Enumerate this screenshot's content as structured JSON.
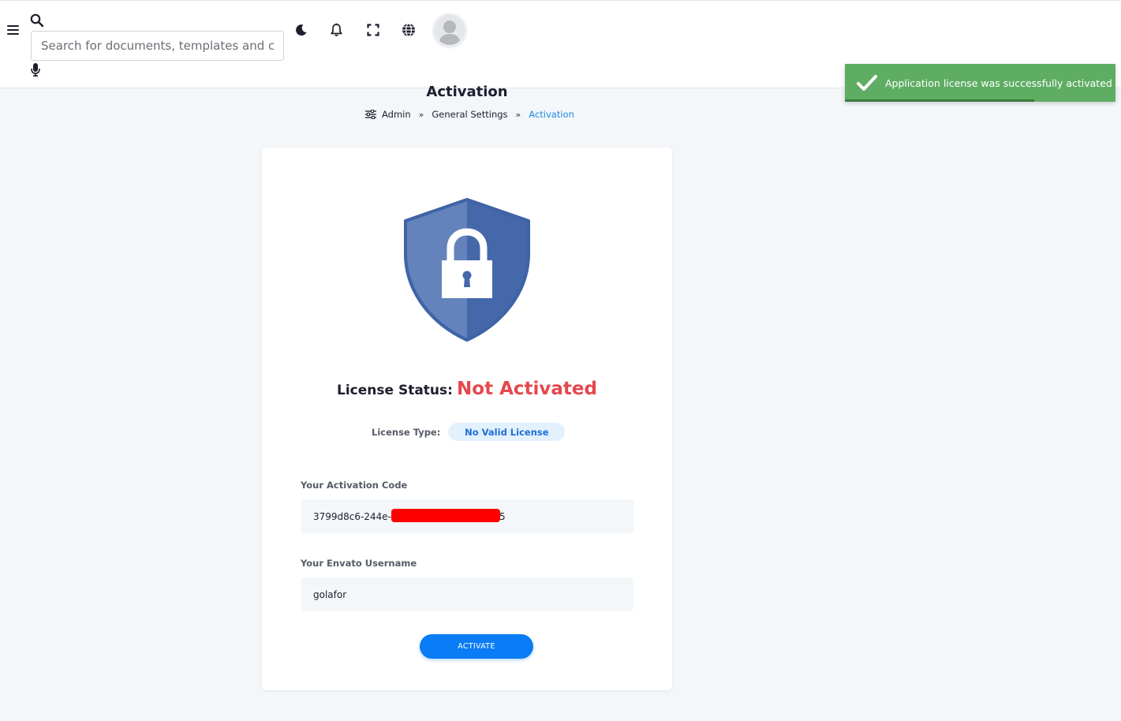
{
  "header": {
    "search_placeholder": "Search for documents, templates and chatbots..."
  },
  "toast": {
    "message": "Application license was successfully activated",
    "progress_percent": 70
  },
  "page": {
    "title": "Activation",
    "breadcrumb": [
      "Admin",
      "General Settings",
      "Activation"
    ],
    "breadcrumb_separator": "»"
  },
  "card": {
    "status_label": "License Status:",
    "status_value": "Not Activated",
    "type_label": "License Type:",
    "type_value": "No Valid License",
    "activation_code_label": "Your Activation Code",
    "activation_code_value": "3799d8c6-244e-                              e025",
    "username_label": "Your Envato Username",
    "username_value": "golafor",
    "activate_label": "ACTIVATE"
  },
  "colors": {
    "accent": "#0a7cf5",
    "status_error": "#e5484d",
    "toast_bg": "#5fad63",
    "shield": "#4a6fae"
  },
  "icons": {
    "menu": "hamburger-icon",
    "search": "search-icon",
    "mic": "microphone-icon",
    "dark_mode": "moon-icon",
    "notifications": "bell-icon",
    "fullscreen": "expand-icon",
    "language": "globe-icon",
    "avatar": "user-avatar",
    "breadcrumb": "sliders-icon",
    "toast": "check-icon",
    "license": "shield-lock-icon"
  }
}
